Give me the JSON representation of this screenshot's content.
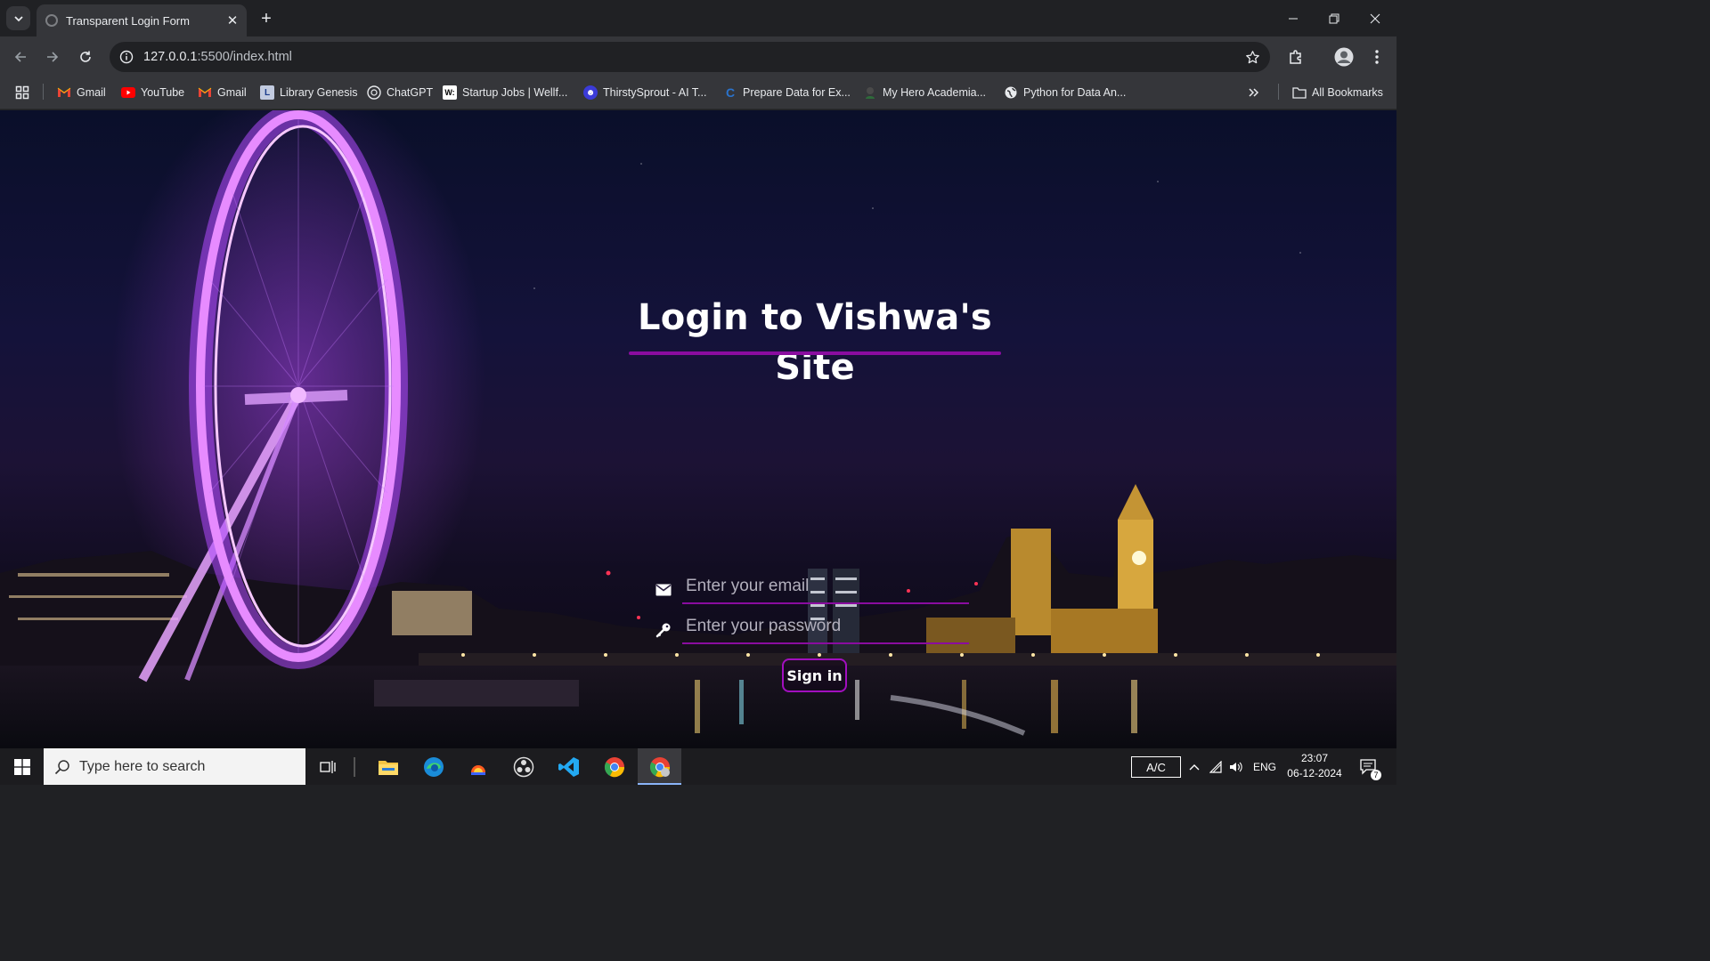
{
  "browser": {
    "tab_title": "Transparent Login Form",
    "url_host": "127.0.0.1",
    "url_path": ":5500/index.html"
  },
  "bookmarks": {
    "items": [
      {
        "label": "Gmail",
        "icon": "gmail-icon"
      },
      {
        "label": "YouTube",
        "icon": "youtube-icon"
      },
      {
        "label": "Gmail",
        "icon": "gmail-icon"
      },
      {
        "label": "Library Genesis",
        "icon": "library-genesis-icon"
      },
      {
        "label": "ChatGPT",
        "icon": "chatgpt-icon"
      },
      {
        "label": "Startup Jobs | Wellf...",
        "icon": "wellfound-icon"
      },
      {
        "label": "ThirstySprout - AI T...",
        "icon": "thirstysprout-icon"
      },
      {
        "label": "Prepare Data for Ex...",
        "icon": "coursera-icon"
      },
      {
        "label": "My Hero Academia...",
        "icon": "anime-icon"
      },
      {
        "label": "Python for Data An...",
        "icon": "globe-icon"
      }
    ],
    "all_bookmarks": "All Bookmarks"
  },
  "login": {
    "title": "Login to Vishwa's Site",
    "email_placeholder": "Enter your email",
    "password_placeholder": "Enter your password",
    "submit_label": "Sign in"
  },
  "taskbar": {
    "search_placeholder": "Type here to search",
    "ac_label": "A/C",
    "language": "ENG",
    "time": "23:07",
    "date": "06-12-2024",
    "notification_count": "7"
  },
  "colors": {
    "accent": "#8a0ca0",
    "button_border": "#a20fbf"
  }
}
